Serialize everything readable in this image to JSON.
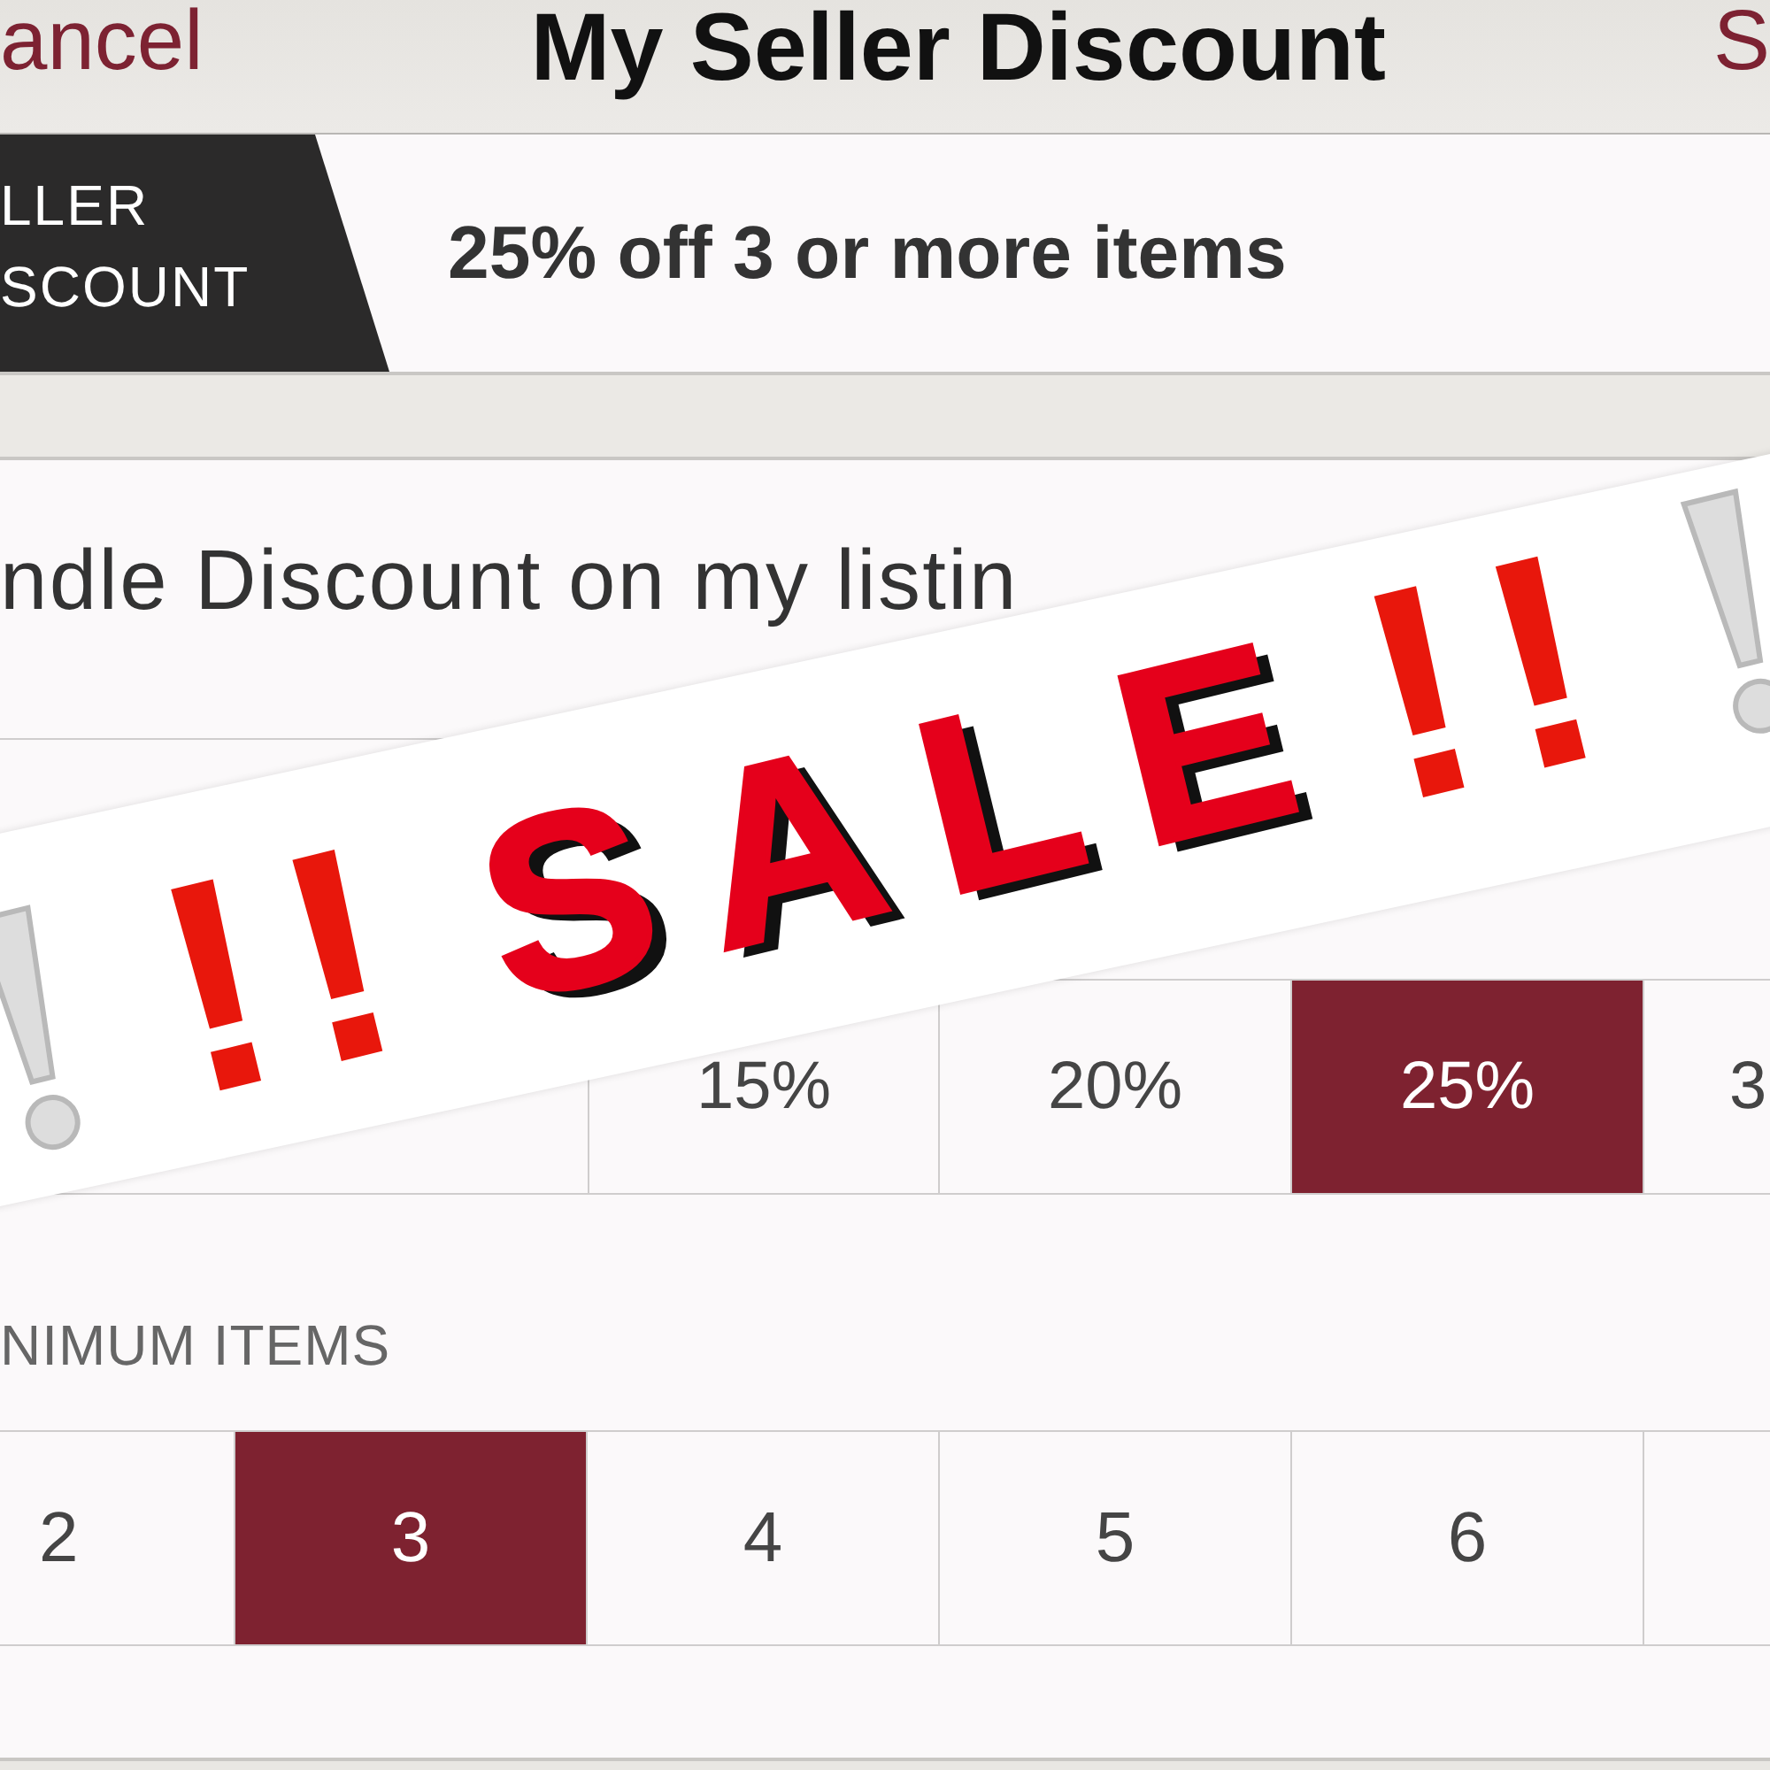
{
  "nav": {
    "cancel": "ancel",
    "title": "My Seller Discount",
    "save": "S"
  },
  "discount_summary": {
    "tag_lines": [
      "LLER",
      "SCOUNT"
    ],
    "text": "25% off 3 or more items"
  },
  "bundle_toggle": {
    "label": "ndle Discount on my listin"
  },
  "percent_options": [
    {
      "label": "15%",
      "selected": false
    },
    {
      "label": "20%",
      "selected": false
    },
    {
      "label": "25%",
      "selected": true
    },
    {
      "label": "3",
      "selected": false
    }
  ],
  "minimum_items": {
    "label": "NIMUM ITEMS",
    "options": [
      {
        "label": "2",
        "selected": false
      },
      {
        "label": "3",
        "selected": true
      },
      {
        "label": "4",
        "selected": false
      },
      {
        "label": "5",
        "selected": false
      },
      {
        "label": "6",
        "selected": false
      }
    ]
  },
  "sale_banner": {
    "left_marks": "!!",
    "text": "SALE",
    "right_marks": "!!"
  }
}
